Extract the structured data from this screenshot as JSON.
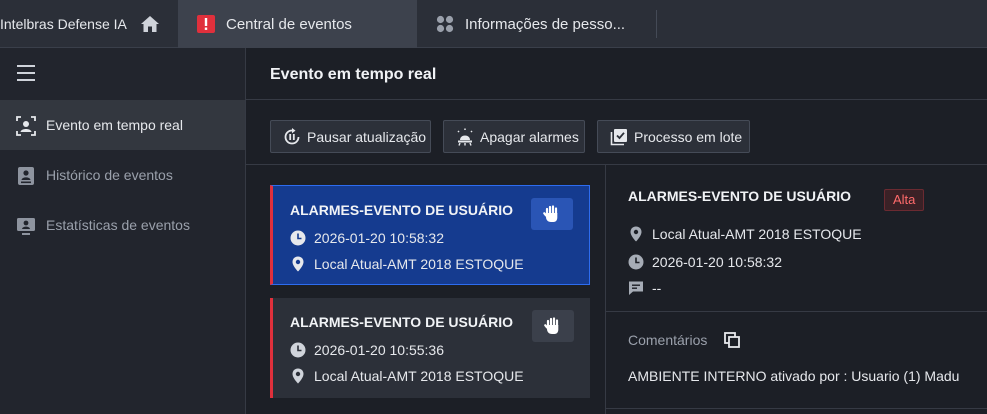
{
  "app": {
    "brand": "Intelbras Defense IA"
  },
  "tabs": [
    {
      "label": "Central de eventos",
      "icon": "alert-icon",
      "active": true
    },
    {
      "label": "Informações de pesso...",
      "icon": "apps-icon",
      "active": false
    }
  ],
  "sidebar": {
    "items": [
      {
        "label": "Evento em tempo real",
        "icon": "live-event-icon",
        "active": true
      },
      {
        "label": "Histórico de eventos",
        "icon": "history-icon",
        "active": false
      },
      {
        "label": "Estatísticas de eventos",
        "icon": "statistics-icon",
        "active": false
      }
    ]
  },
  "main": {
    "title": "Evento em tempo real",
    "toolbar": {
      "pause": "Pausar atualização",
      "clear": "Apagar alarmes",
      "batch": "Processo em lote"
    }
  },
  "events": [
    {
      "title": "ALARMES-EVENTO DE USUÁRIO",
      "time": "2026-01-20 10:58:32",
      "location": "Local Atual-AMT 2018 ESTOQUE",
      "selected": true
    },
    {
      "title": "ALARMES-EVENTO DE USUÁRIO",
      "time": "2026-01-20 10:55:36",
      "location": "Local Atual-AMT 2018 ESTOQUE",
      "selected": false
    }
  ],
  "detail": {
    "title": "ALARMES-EVENTO DE USUÁRIO",
    "priority": "Alta",
    "location": "Local Atual-AMT 2018 ESTOQUE",
    "time": "2026-01-20 10:58:32",
    "description": "--",
    "comments_label": "Comentários",
    "comment": "AMBIENTE INTERNO ativado por : Usuario (1) Madu"
  },
  "colors": {
    "accent_blue": "#2d6cf0",
    "alarm_red": "#e0303c",
    "background": "#1c1f26"
  }
}
